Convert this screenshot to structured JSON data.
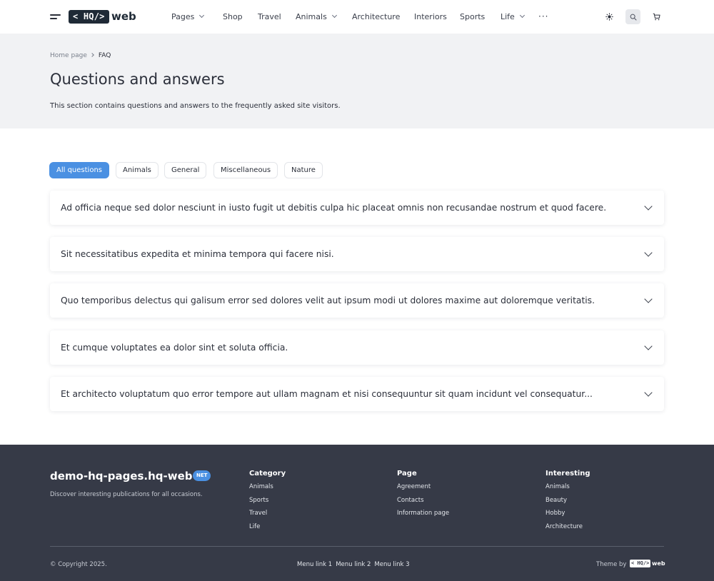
{
  "header": {
    "logo_text": "< HQ/>",
    "logo_suffix": "web",
    "nav": [
      {
        "label": "Pages"
      },
      {
        "label": "Shop"
      },
      {
        "label": "Travel"
      },
      {
        "label": "Animals"
      },
      {
        "label": "Architecture"
      },
      {
        "label": "Interiors"
      },
      {
        "label": "Sports"
      },
      {
        "label": "Life"
      }
    ],
    "more": "···",
    "icons": {
      "theme": "sun-icon",
      "search": "search-icon",
      "cart": "cart-icon",
      "menu": "hamburger-icon"
    }
  },
  "hero": {
    "breadcrumb": {
      "home": "Home page",
      "current": "FAQ"
    },
    "title": "Questions and answers",
    "subtitle": "This section contains questions and answers to the frequently asked site visitors."
  },
  "filters": [
    {
      "label": "All questions",
      "active": true
    },
    {
      "label": "Animals",
      "active": false
    },
    {
      "label": "General",
      "active": false
    },
    {
      "label": "Miscellaneous",
      "active": false
    },
    {
      "label": "Nature",
      "active": false
    }
  ],
  "faq": [
    {
      "question": "Ad officia neque sed dolor nesciunt in iusto fugit ut debitis culpa hic placeat omnis non recusandae nostrum et quod facere."
    },
    {
      "question": "Sit necessitatibus expedita et minima tempora qui facere nisi."
    },
    {
      "question": "Quo temporibus delectus qui galisum error sed dolores velit aut ipsum modi ut dolores maxime aut doloremque veritatis."
    },
    {
      "question": "Et cumque voluptates ea dolor sint et soluta officia."
    },
    {
      "question": "Et architecto voluptatum quo error tempore aut ullam magnam et nisi consequuntur sit quam incidunt vel consequatur..."
    }
  ],
  "footer": {
    "site": "demo-hq-pages.hq-web",
    "badge": "NET",
    "description": "Discover interesting publications for all occasions.",
    "columns": [
      {
        "title": "Category",
        "links": [
          "Animals",
          "Sports",
          "Travel",
          "Life"
        ]
      },
      {
        "title": "Page",
        "links": [
          "Agreement",
          "Contacts",
          "Information page"
        ]
      },
      {
        "title": "Interesting",
        "links": [
          "Animals",
          "Beauty",
          "Hobby",
          "Architecture"
        ]
      }
    ],
    "copyright": "© Copyright 2025.",
    "menu_links": [
      "Menu link 1",
      "Menu link 2",
      "Menu link 3"
    ],
    "theme_by": "Theme by",
    "theme_logo": "< HQ/>",
    "theme_logo_suffix": "web"
  },
  "colors": {
    "accent": "#4a90e2",
    "footer_bg": "#363a47",
    "hero_bg": "#f1f2f4",
    "logo_bg": "#1f2a36"
  }
}
